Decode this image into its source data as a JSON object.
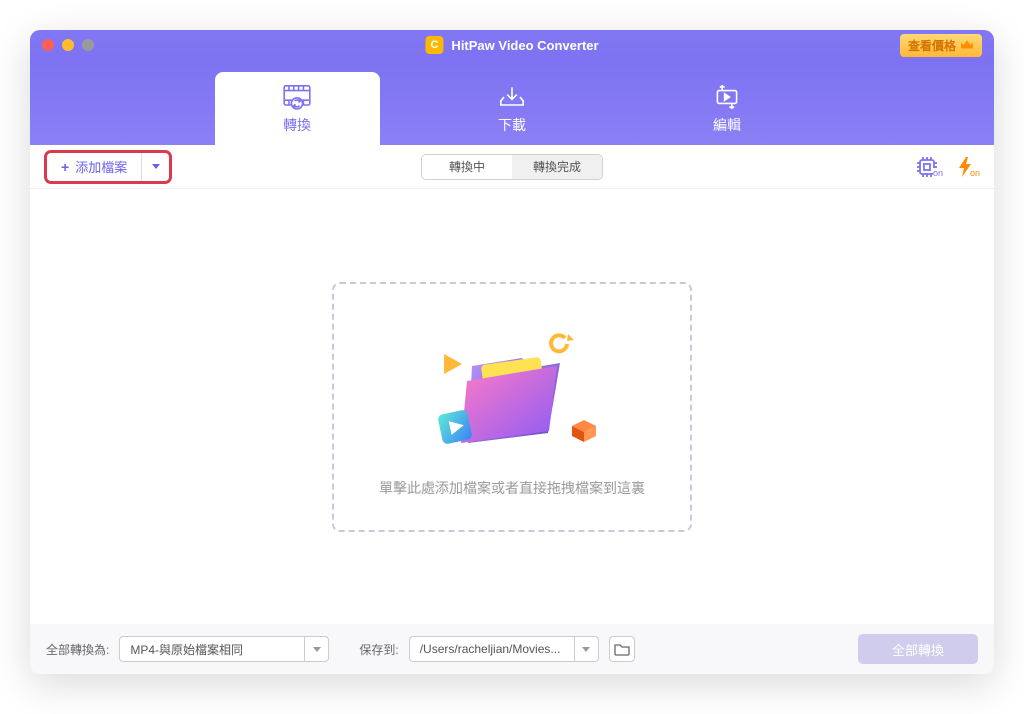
{
  "title": "HitPaw Video Converter",
  "price_button": "查看價格",
  "tabs": {
    "convert": "轉換",
    "download": "下載",
    "edit": "編輯"
  },
  "toolbar": {
    "add_file": "添加檔案",
    "seg_converting": "轉換中",
    "seg_completed": "轉換完成"
  },
  "gpu_badge": "on",
  "flash_badge": "on",
  "drop_zone": {
    "text": "單擊此處添加檔案或者直接拖拽檔案到這裏"
  },
  "footer": {
    "convert_all_to_label": "全部轉換為:",
    "format_value": "MP4-與原始檔案相同",
    "save_to_label": "保存到:",
    "save_path": "/Users/racheljian/Movies...",
    "convert_all_btn": "全部轉換"
  }
}
